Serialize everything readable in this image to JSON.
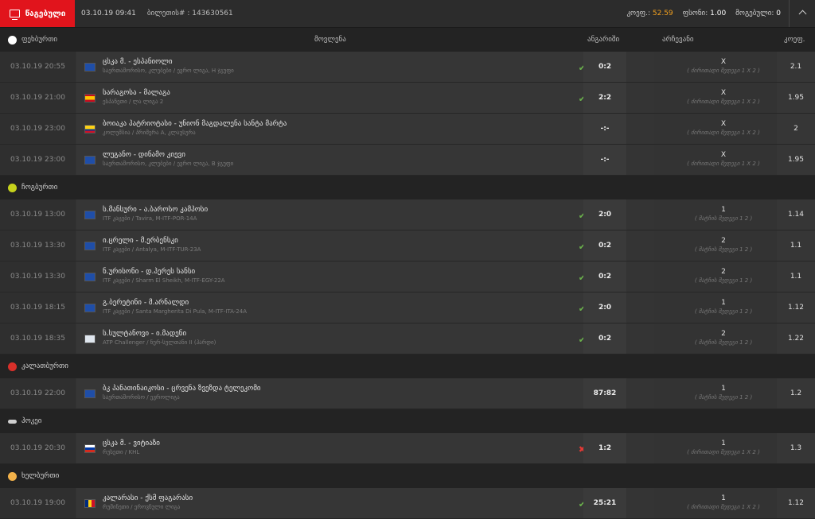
{
  "topbar": {
    "status_label": "წაგებული",
    "datetime": "03.10.19 09:41",
    "ticket_label": "ბილეთის# : 143630561",
    "odds_label": "კოეფ.:",
    "odds_value": "52.59",
    "stake_label": "ფსონი:",
    "stake_value": "1.00",
    "win_label": "მოგებული:",
    "win_value": "0"
  },
  "columns": {
    "event": "მოვლენა",
    "score": "ანგარიში",
    "pick": "არჩევანი",
    "odds": "კოეფ."
  },
  "sports": [
    {
      "name": "ფეხბურთი",
      "icon": "soccer-ball-icon",
      "color": "#ffffff",
      "matches": [
        {
          "time": "03.10.19 20:55",
          "flag": "eu",
          "name": "ცსკა მ. - ესპანიოლი",
          "sub": "საერთაშორისო, კლუბები / ევრო ლიგა, H ჯგუფი",
          "result": "ok",
          "score": "0:2",
          "pick": "X",
          "note": "( ძირითადი შედეგი 1 X 2 )",
          "odds": "2.1"
        },
        {
          "time": "03.10.19 21:00",
          "flag": "es",
          "name": "სარაგოსა - მალაგა",
          "sub": "ესპანეთი / ლა ლიგა 2",
          "result": "ok",
          "score": "2:2",
          "pick": "X",
          "note": "( ძირითადი შედეგი 1 X 2 )",
          "odds": "1.95"
        },
        {
          "time": "03.10.19 23:00",
          "flag": "co",
          "name": "ბოიაკა პატრიოტასი - უნიონ მაგდალენა სანტა მარტა",
          "sub": "კოლუმბია / პრიმერა A, კლაუსურა",
          "result": "",
          "score": "-:-",
          "pick": "X",
          "note": "( ძირითადი შედეგი 1 X 2 )",
          "odds": "2"
        },
        {
          "time": "03.10.19 23:00",
          "flag": "eu",
          "name": "ლუგანო - დინამო კიევი",
          "sub": "საერთაშორისო, კლუბები / ევრო ლიგა, B ჯგუფი",
          "result": "",
          "score": "-:-",
          "pick": "X",
          "note": "( ძირითადი შედეგი 1 X 2 )",
          "odds": "1.95"
        }
      ]
    },
    {
      "name": "ჩოგბურთი",
      "icon": "tennis-ball-icon",
      "color": "#c6d21c",
      "matches": [
        {
          "time": "03.10.19 13:00",
          "flag": "eu",
          "name": "ს.მანსური - ა.ბაროსო კამპოსი",
          "sub": "ITF კაცები / Tavira, M-ITF-POR-14A",
          "result": "ok",
          "score": "2:0",
          "pick": "1",
          "note": "( მატჩის შედეგი 1 2 )",
          "odds": "1.14"
        },
        {
          "time": "03.10.19 13:30",
          "flag": "eu",
          "name": "ი.ცრელი - მ.ერბენსკი",
          "sub": "ITF კაცები / Antalya, M-ITF-TUR-23A",
          "result": "ok",
          "score": "0:2",
          "pick": "2",
          "note": "( მატჩის შედეგი 1 2 )",
          "odds": "1.1"
        },
        {
          "time": "03.10.19 13:30",
          "flag": "eu",
          "name": "ნ.ურისონი - დ.პერეს სანსი",
          "sub": "ITF კაცები / Sharm El Sheikh, M-ITF-EGY-22A",
          "result": "ok",
          "score": "0:2",
          "pick": "2",
          "note": "( მატჩის შედეგი 1 2 )",
          "odds": "1.1"
        },
        {
          "time": "03.10.19 18:15",
          "flag": "eu",
          "name": "გ.ბერეტინი - მ.არნალდი",
          "sub": "ITF კაცები / Santa Margherita Di Pula, M-ITF-ITA-24A",
          "result": "ok",
          "score": "2:0",
          "pick": "1",
          "note": "( მატჩის შედეგი 1 2 )",
          "odds": "1.12"
        },
        {
          "time": "03.10.19 18:35",
          "flag": "atp",
          "name": "ს.სულტანოვი - ი.მადენი",
          "sub": "ATP Challenger / ნურ-სულთანი II (ჰარდი)",
          "result": "ok",
          "score": "0:2",
          "pick": "2",
          "note": "( მატჩის შედეგი 1 2 )",
          "odds": "1.22"
        }
      ]
    },
    {
      "name": "კალათბურთი",
      "icon": "basketball-icon",
      "color": "#d8302a",
      "matches": [
        {
          "time": "03.10.19 22:00",
          "flag": "eu",
          "name": "ბკ პანათინაიკოსი - ცრვენა ზვეზდა ტელეკომი",
          "sub": "საერთაშორისო / ევროლიგა",
          "result": "",
          "score": "87:82",
          "pick": "1",
          "note": "( მატჩის შედეგი 1 2 )",
          "odds": "1.2"
        }
      ]
    },
    {
      "name": "ჰოკეი",
      "icon": "hockey-puck-icon",
      "color": "#cfcfcf",
      "matches": [
        {
          "time": "03.10.19 20:30",
          "flag": "ru",
          "name": "ცსკა მ. - ვიტიაზი",
          "sub": "რუსეთი / KHL",
          "result": "bad",
          "score": "1:2",
          "pick": "1",
          "note": "( ძირითადი შედეგი 1 X 2 )",
          "odds": "1.3"
        }
      ]
    },
    {
      "name": "ხელბურთი",
      "icon": "handball-icon",
      "color": "#f3b24a",
      "matches": [
        {
          "time": "03.10.19 19:00",
          "flag": "ro",
          "name": "კალარასი - ქსმ ფაგარასი",
          "sub": "რუმინეთი / ეროვნული ლიგა",
          "result": "ok",
          "score": "25:21",
          "pick": "1",
          "note": "( ძირითადი შედეგი 1 X 2 )",
          "odds": "1.12"
        }
      ]
    }
  ]
}
